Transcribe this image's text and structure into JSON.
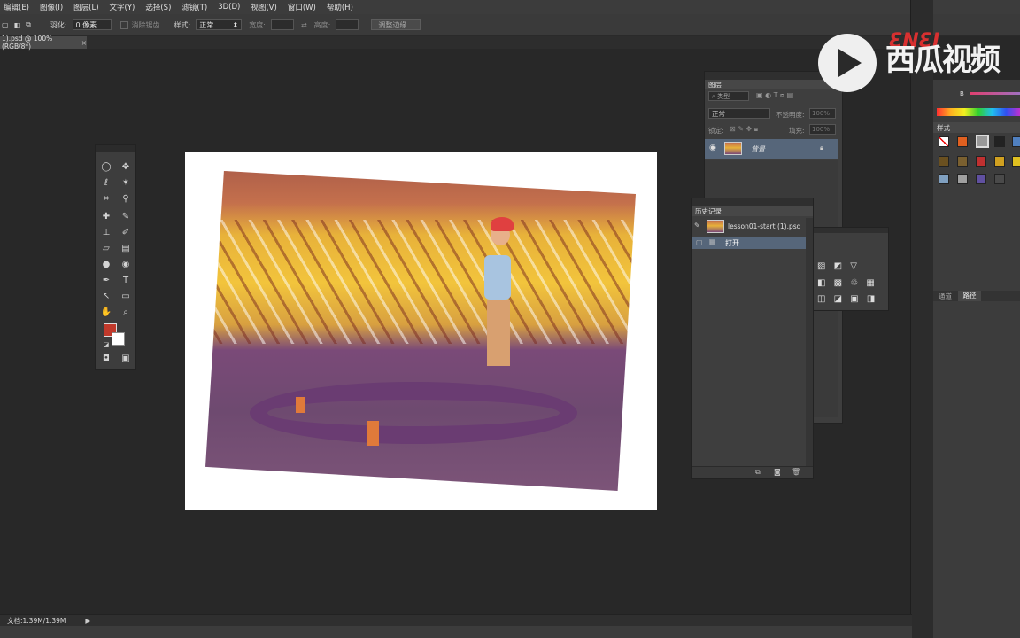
{
  "menu": [
    "编辑(E)",
    "图像(I)",
    "图层(L)",
    "文字(Y)",
    "选择(S)",
    "滤镜(T)",
    "3D(D)",
    "视图(V)",
    "窗口(W)",
    "帮助(H)"
  ],
  "options": {
    "feather_label": "羽化:",
    "feather_value": "0 像素",
    "antialias_label": "消除锯齿",
    "style_label": "样式:",
    "style_value": "正常",
    "width_label": "宽度:",
    "height_label": "高度:",
    "refine_edge_button": "调整边缘..."
  },
  "doc_tab": {
    "title": "1).psd @ 100%(RGB/8*)",
    "close": "×"
  },
  "layers_panel": {
    "title": "图层",
    "filter_kind": "类型",
    "blend_mode": "正常",
    "opacity_label": "不透明度:",
    "opacity_value": "100%",
    "lock_label": "锁定:",
    "fill_label": "填充:",
    "fill_value": "100%",
    "layer_name": "背景"
  },
  "history_panel": {
    "title": "历史记录",
    "snapshot_name": "lesson01-start (1).psd",
    "step": "打开"
  },
  "right_panels": {
    "styles_title": "样式",
    "channels_tab": "通道",
    "paths_tab": "路径",
    "color_b_label": "B"
  },
  "status": {
    "doc_info": "文档:1.39M/1.39M"
  },
  "watermark": {
    "logo_text": "ƐNƐI",
    "text": "西瓜视频"
  },
  "colors": {
    "foreground": "#c0392b",
    "background": "#ffffff",
    "selection": "#56667a"
  }
}
